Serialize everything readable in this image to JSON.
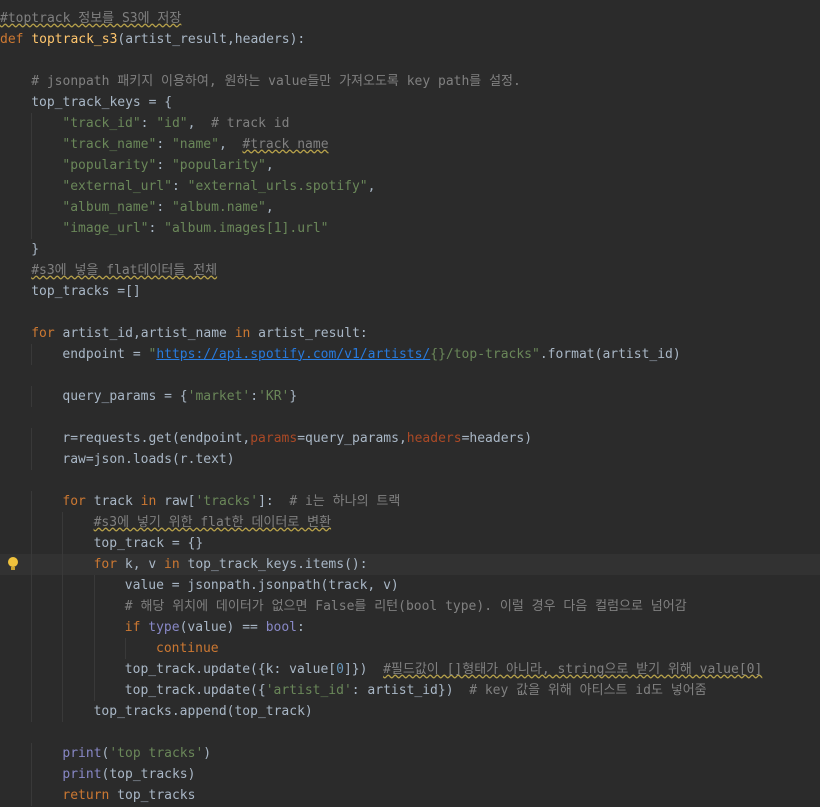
{
  "editor": {
    "gutter": {
      "intention_icon": "lightbulb-icon"
    },
    "lines": [
      {
        "indent": 0,
        "tokens": [
          {
            "t": "#toptrack 정보를 S3에 저장",
            "c": "cm wvy"
          }
        ]
      },
      {
        "indent": 0,
        "tokens": [
          {
            "t": "def",
            "c": "kw"
          },
          {
            "t": " "
          },
          {
            "t": "toptrack_s3",
            "c": "fn"
          },
          {
            "t": "(artist_result,headers):"
          }
        ]
      },
      {
        "indent": 0,
        "tokens": []
      },
      {
        "indent": 4,
        "tokens": [
          {
            "t": "# jsonpath 패키지 이용하여, 원하는 value들만 가져오도록 key path를 설정.",
            "c": "cm"
          }
        ]
      },
      {
        "indent": 4,
        "tokens": [
          {
            "t": "top_track_keys = {"
          }
        ]
      },
      {
        "indent": 8,
        "tokens": [
          {
            "t": "\"track_id\"",
            "c": "str"
          },
          {
            "t": ": "
          },
          {
            "t": "\"id\"",
            "c": "str"
          },
          {
            "t": ",  "
          },
          {
            "t": "# track id",
            "c": "cm"
          }
        ]
      },
      {
        "indent": 8,
        "tokens": [
          {
            "t": "\"track_name\"",
            "c": "str"
          },
          {
            "t": ": "
          },
          {
            "t": "\"name\"",
            "c": "str"
          },
          {
            "t": ",  "
          },
          {
            "t": "#track name",
            "c": "cm wvy"
          }
        ]
      },
      {
        "indent": 8,
        "tokens": [
          {
            "t": "\"popularity\"",
            "c": "str"
          },
          {
            "t": ": "
          },
          {
            "t": "\"popularity\"",
            "c": "str"
          },
          {
            "t": ","
          }
        ]
      },
      {
        "indent": 8,
        "tokens": [
          {
            "t": "\"external_url\"",
            "c": "str"
          },
          {
            "t": ": "
          },
          {
            "t": "\"external_urls.spotify\"",
            "c": "str"
          },
          {
            "t": ","
          }
        ]
      },
      {
        "indent": 8,
        "tokens": [
          {
            "t": "\"album_name\"",
            "c": "str"
          },
          {
            "t": ": "
          },
          {
            "t": "\"album.name\"",
            "c": "str"
          },
          {
            "t": ","
          }
        ]
      },
      {
        "indent": 8,
        "tokens": [
          {
            "t": "\"image_url\"",
            "c": "str"
          },
          {
            "t": ": "
          },
          {
            "t": "\"album.images[1].url\"",
            "c": "str"
          }
        ]
      },
      {
        "indent": 4,
        "tokens": [
          {
            "t": "}"
          }
        ]
      },
      {
        "indent": 4,
        "tokens": [
          {
            "t": "#s3에 넣을 flat데이터들 전체",
            "c": "cm wvy"
          }
        ]
      },
      {
        "indent": 4,
        "tokens": [
          {
            "t": "top_tracks =[]"
          }
        ]
      },
      {
        "indent": 0,
        "tokens": []
      },
      {
        "indent": 4,
        "tokens": [
          {
            "t": "for",
            "c": "kw"
          },
          {
            "t": " artist_id,artist_name "
          },
          {
            "t": "in",
            "c": "kw"
          },
          {
            "t": " artist_result:"
          }
        ]
      },
      {
        "indent": 8,
        "tokens": [
          {
            "t": "endpoint = "
          },
          {
            "t": "\"",
            "c": "str"
          },
          {
            "t": "https://api.spotify.com/v1/artists/",
            "c": "url"
          },
          {
            "t": "{}/top-tracks\"",
            "c": "str"
          },
          {
            "t": ".format(artist_id)"
          }
        ]
      },
      {
        "indent": 0,
        "tokens": []
      },
      {
        "indent": 8,
        "tokens": [
          {
            "t": "query_params = {"
          },
          {
            "t": "'market'",
            "c": "str"
          },
          {
            "t": ":"
          },
          {
            "t": "'KR'",
            "c": "str"
          },
          {
            "t": "}"
          }
        ]
      },
      {
        "indent": 0,
        "tokens": []
      },
      {
        "indent": 8,
        "tokens": [
          {
            "t": "r=requests.get(endpoint,"
          },
          {
            "t": "params",
            "c": "par"
          },
          {
            "t": "=query_params,"
          },
          {
            "t": "headers",
            "c": "par"
          },
          {
            "t": "=headers)"
          }
        ]
      },
      {
        "indent": 8,
        "tokens": [
          {
            "t": "raw=json.loads(r.text)"
          }
        ]
      },
      {
        "indent": 0,
        "tokens": []
      },
      {
        "indent": 8,
        "tokens": [
          {
            "t": "for",
            "c": "kw"
          },
          {
            "t": " track "
          },
          {
            "t": "in",
            "c": "kw"
          },
          {
            "t": " raw["
          },
          {
            "t": "'tracks'",
            "c": "str"
          },
          {
            "t": "]:  "
          },
          {
            "t": "# i는 하나의 트랙",
            "c": "cm"
          }
        ]
      },
      {
        "indent": 12,
        "tokens": [
          {
            "t": "#s3에 넣기 위한 flat한 데이터로 변환",
            "c": "cm wvy"
          }
        ]
      },
      {
        "indent": 12,
        "tokens": [
          {
            "t": "top_track = {}"
          }
        ]
      },
      {
        "indent": 12,
        "current": true,
        "tokens": [
          {
            "t": "for",
            "c": "kw"
          },
          {
            "t": " k, v "
          },
          {
            "t": "in",
            "c": "kw"
          },
          {
            "t": " top_track_keys.items():"
          }
        ]
      },
      {
        "indent": 16,
        "tokens": [
          {
            "t": "value = jsonpath.jsonpath(track, v)"
          }
        ]
      },
      {
        "indent": 16,
        "tokens": [
          {
            "t": "# 해당 위치에 데이터가 없으면 False를 리턴(bool type). 이럴 경우 다음 컬럼으로 넘어감",
            "c": "cm"
          }
        ]
      },
      {
        "indent": 16,
        "tokens": [
          {
            "t": "if",
            "c": "kw"
          },
          {
            "t": " "
          },
          {
            "t": "type",
            "c": "bi"
          },
          {
            "t": "(value) == "
          },
          {
            "t": "bool",
            "c": "bi"
          },
          {
            "t": ":"
          }
        ]
      },
      {
        "indent": 20,
        "tokens": [
          {
            "t": "continue",
            "c": "kw"
          }
        ]
      },
      {
        "indent": 16,
        "tokens": [
          {
            "t": "top_track.update({k: value["
          },
          {
            "t": "0",
            "c": "num"
          },
          {
            "t": "]})  "
          },
          {
            "t": "#필드값이 []형태가 아니라, string으로 받기 위해 value[0]",
            "c": "cm wvy"
          }
        ]
      },
      {
        "indent": 16,
        "tokens": [
          {
            "t": "top_track.update({"
          },
          {
            "t": "'artist_id'",
            "c": "str"
          },
          {
            "t": ": artist_id})  "
          },
          {
            "t": "# key 값을 위해 아티스트 id도 넣어줌",
            "c": "cm"
          }
        ]
      },
      {
        "indent": 12,
        "tokens": [
          {
            "t": "top_tracks.append(top_track)"
          }
        ]
      },
      {
        "indent": 0,
        "tokens": []
      },
      {
        "indent": 8,
        "tokens": [
          {
            "t": "print",
            "c": "bi"
          },
          {
            "t": "("
          },
          {
            "t": "'top tracks'",
            "c": "str"
          },
          {
            "t": ")"
          }
        ]
      },
      {
        "indent": 8,
        "tokens": [
          {
            "t": "print",
            "c": "bi"
          },
          {
            "t": "(top_tracks)"
          }
        ]
      },
      {
        "indent": 8,
        "tokens": [
          {
            "t": "return",
            "c": "kw"
          },
          {
            "t": " top_tracks"
          }
        ]
      }
    ]
  }
}
